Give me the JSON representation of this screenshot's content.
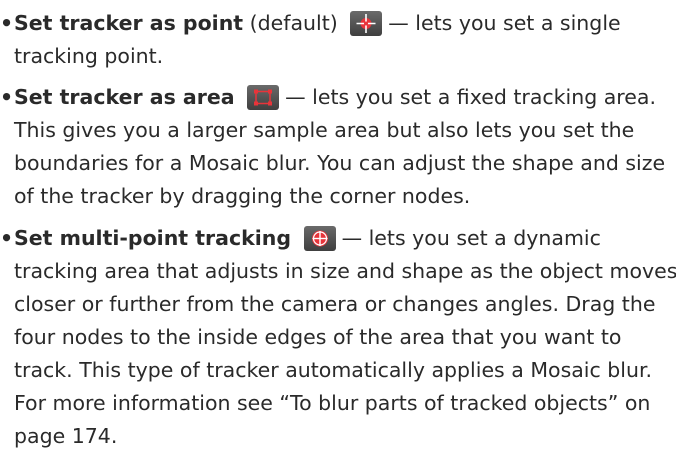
{
  "items": [
    {
      "term": "Set tracker as point",
      "after_term": " (default) ",
      "icon": "crosshair-point-icon",
      "desc_first": "— lets you set a single",
      "lines": [
        "tracking point."
      ]
    },
    {
      "term": "Set tracker as area",
      "icon": "tracker-area-icon",
      "desc_first": "— lets you set a fixed tracking area.",
      "lines": [
        "This gives you a larger sample area but also lets you set the",
        "boundaries for a Mosaic blur. You can adjust the shape and size",
        "of the tracker by dragging the corner nodes."
      ]
    },
    {
      "term": "Set multi-point tracking",
      "icon": "multi-point-tracking-icon",
      "desc_first": "— lets you set a dynamic",
      "lines": [
        "tracking area that adjusts in size and shape as the object moves",
        "closer or further from the camera or changes angles. Drag the",
        "four nodes to the inside edges of the area that you want to",
        "track. This type of tracker automatically applies a Mosaic blur.",
        "For more information see “To blur parts of tracked objects” on",
        "page 174."
      ]
    }
  ],
  "colors": {
    "text": "#2a2a2a",
    "icon_bg": "#505050",
    "icon_accent": "#e8343a"
  }
}
